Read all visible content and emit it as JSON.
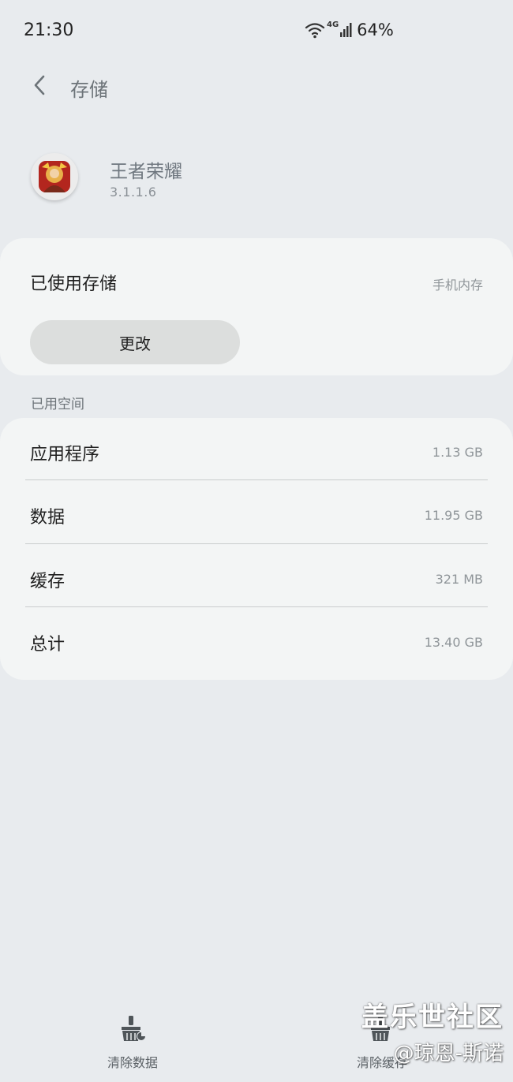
{
  "status_bar": {
    "time": "21:30",
    "network": "4G",
    "battery": "64%"
  },
  "app_bar": {
    "title": "存储"
  },
  "app": {
    "name": "王者荣耀",
    "version": "3.1.1.6"
  },
  "storage_used": {
    "title": "已使用存储",
    "location": "手机内存",
    "change_button": "更改"
  },
  "used_space": {
    "section_label": "已用空间",
    "rows": [
      {
        "label": "应用程序",
        "value": "1.13 GB"
      },
      {
        "label": "数据",
        "value": "11.95 GB"
      },
      {
        "label": "缓存",
        "value": "321 MB"
      },
      {
        "label": "总计",
        "value": "13.40 GB"
      }
    ]
  },
  "bottom_bar": {
    "clear_data": "清除数据",
    "clear_cache": "清除缓存"
  },
  "watermark": {
    "line1": "盖乐世社区",
    "line2": "@琼恩-斯诺"
  }
}
